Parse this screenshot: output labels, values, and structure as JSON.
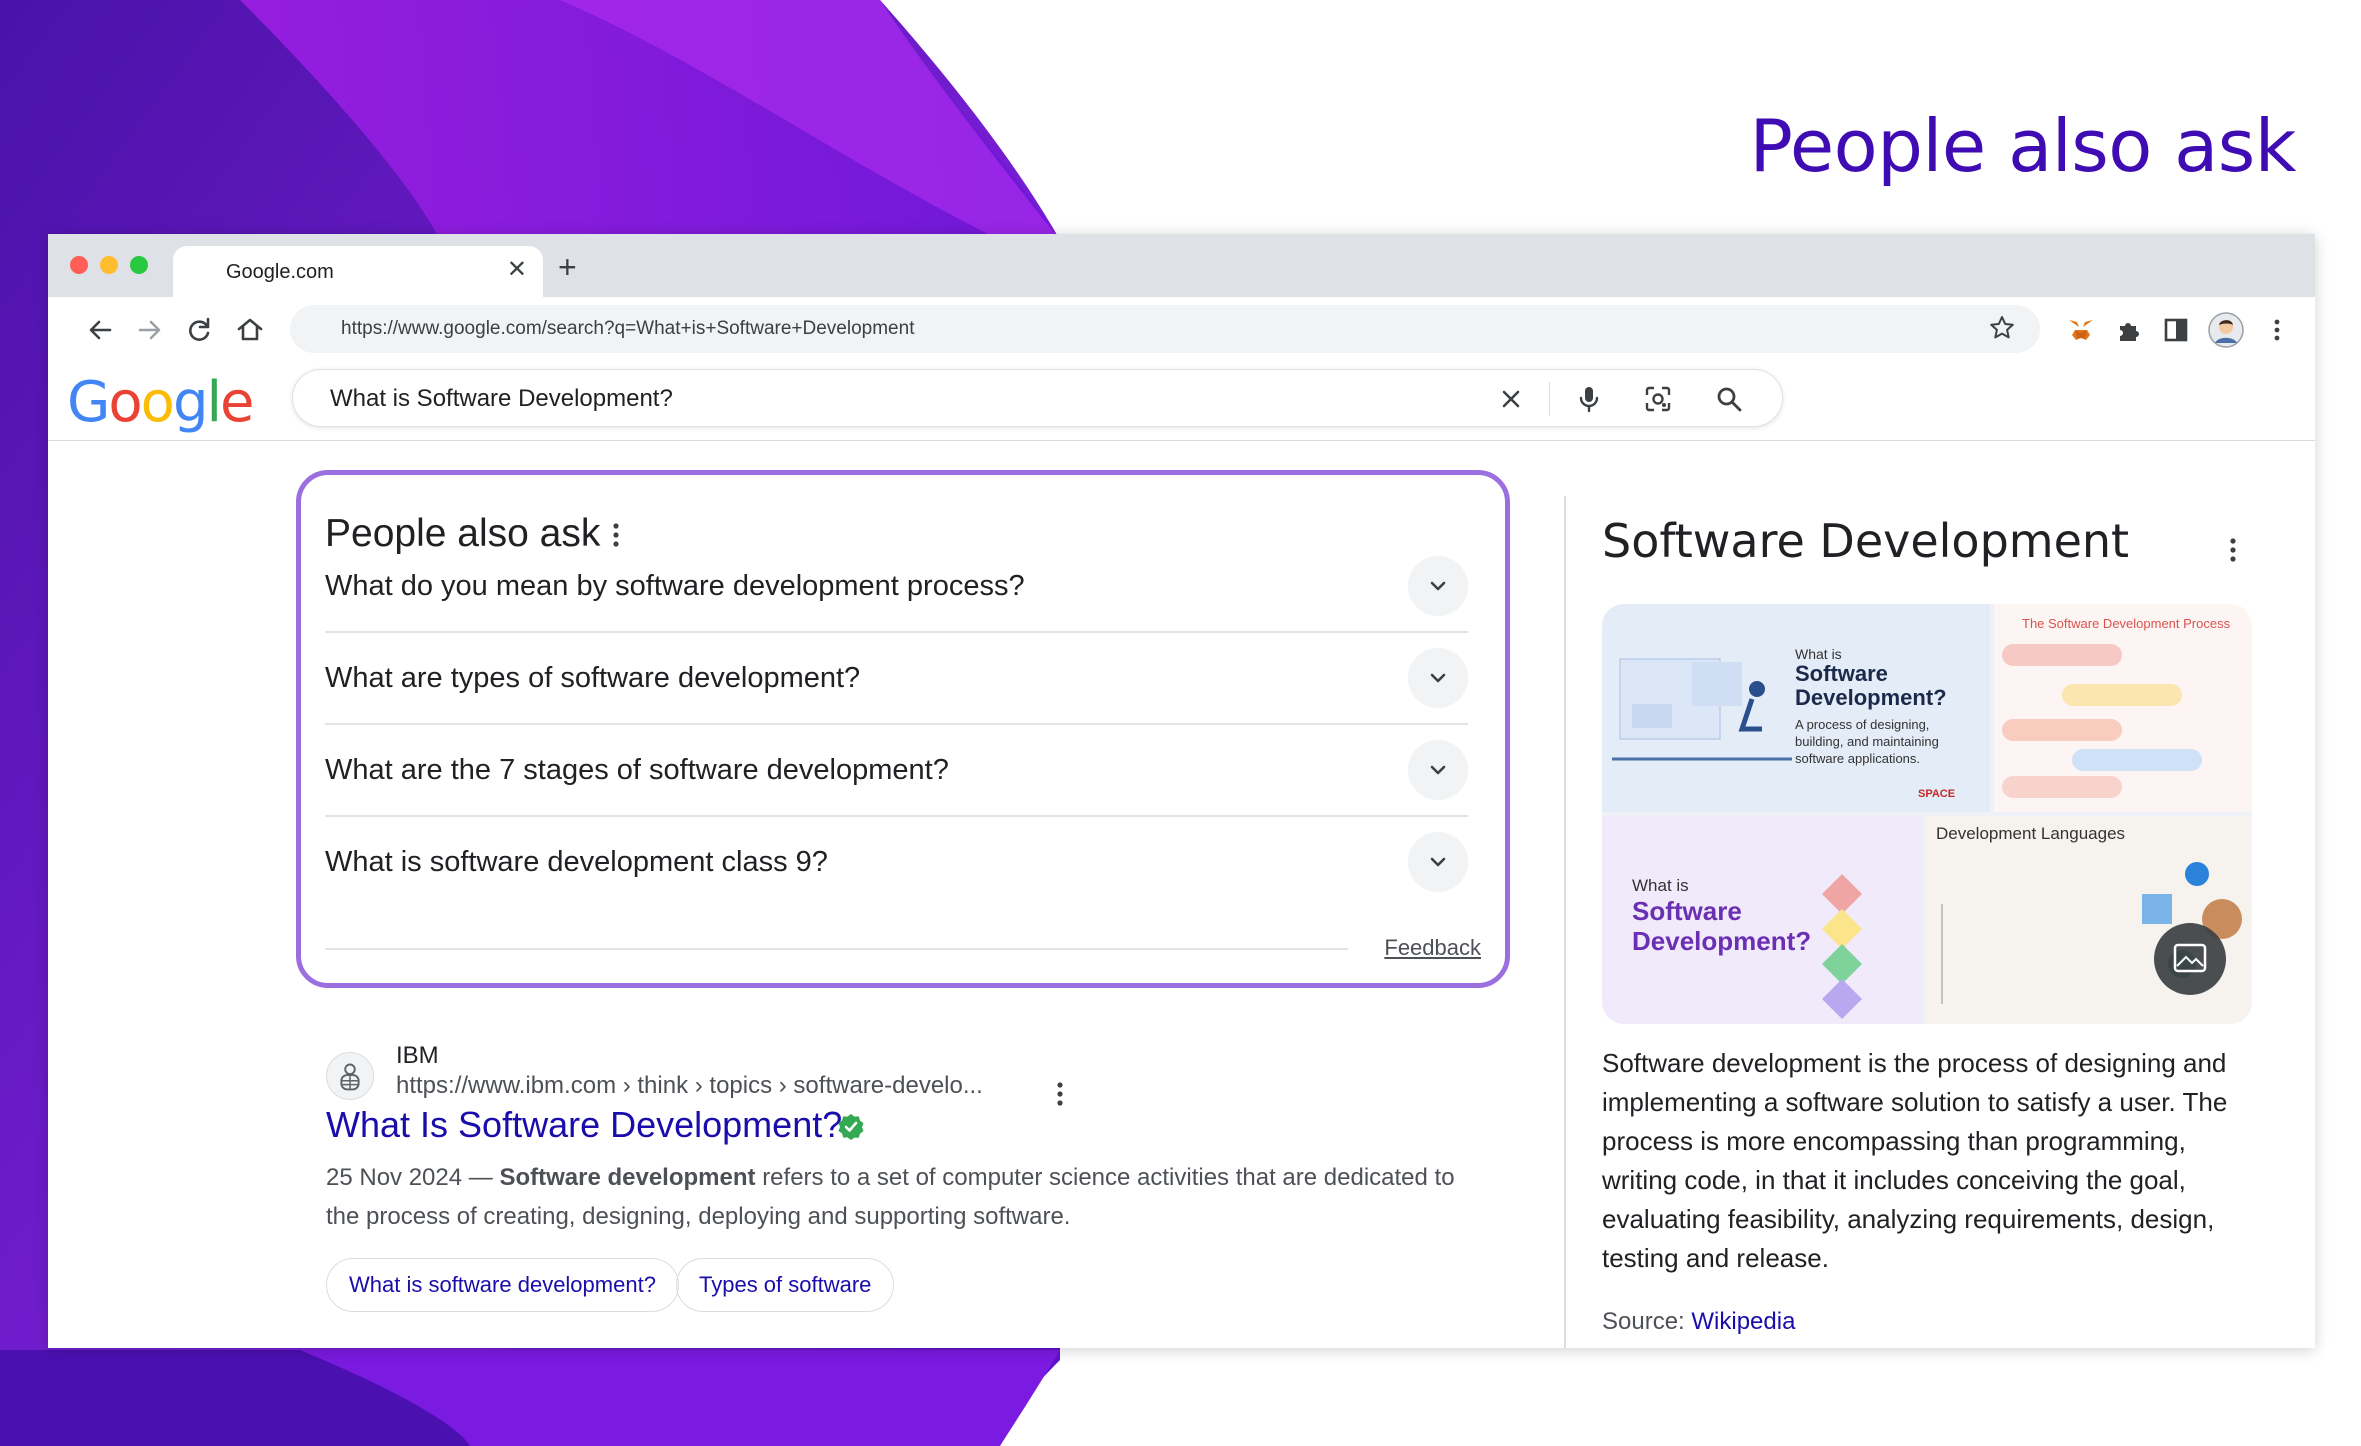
{
  "slide": {
    "headline": "People also ask",
    "brand_color": "#3f0bb3"
  },
  "browser": {
    "tab_title": "Google.com",
    "url": "https://www.google.com/search?q=What+is+Software+Development"
  },
  "google": {
    "logo_letters": [
      "G",
      "o",
      "o",
      "g",
      "l",
      "e"
    ],
    "logo_colors": [
      "#4285f4",
      "#ea4335",
      "#fbbc05",
      "#4285f4",
      "#34a853",
      "#ea4335"
    ],
    "query": "What is Software Development?"
  },
  "paa": {
    "title": "People also ask",
    "questions": [
      "What do you mean by software development process?",
      "What are types of software development?",
      "What are the 7 stages of software development?",
      "What is software development class 9?"
    ],
    "feedback": "Feedback",
    "highlight_color": "#9b6fdf"
  },
  "result": {
    "site_name": "IBM",
    "cite": "https://www.ibm.com › think › topics › software-develo...",
    "title": "What Is Software Development?",
    "date": "25 Nov 2024 —",
    "snippet_bold": "Software development",
    "snippet_rest": "refers to a set of computer science activities that are dedicated to the process of creating, designing, deploying and supporting software.",
    "chips": [
      "What is software development?",
      "Types of software"
    ]
  },
  "knowledge_panel": {
    "title": "Software Development",
    "collage": {
      "tile1_small": "What is",
      "tile1_title_line1": "Software",
      "tile1_title_line2": "Development?",
      "tile1_desc_line1": "A process of designing,",
      "tile1_desc_line2": "building, and maintaining",
      "tile1_desc_line3": "software applications.",
      "tile1_brand": "SPACE",
      "tile2_title": "The Software Development Process",
      "tile3_small": "What is",
      "tile3_title_line1": "Software",
      "tile3_title_line2": "Development?",
      "tile4_title": "Development Languages"
    },
    "description": "Software development is the process of designing and implementing a software solution to satisfy a user. The process is more encompassing than programming, writing code, in that it includes conceiving the goal, evaluating feasibility, analyzing requirements, design, testing and release.",
    "source_label": "Source:",
    "source_link": "Wikipedia"
  }
}
